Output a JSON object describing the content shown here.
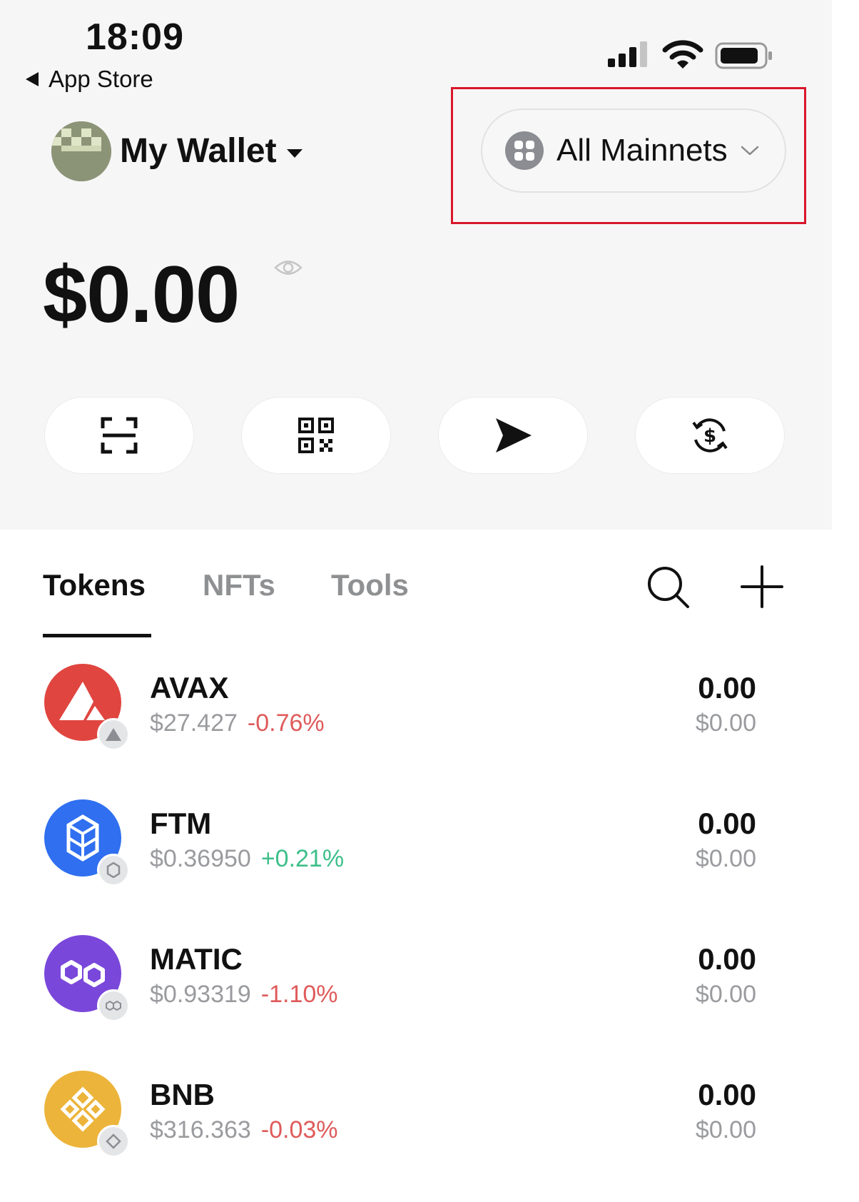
{
  "status_bar": {
    "time": "18:09",
    "back_label": "App Store"
  },
  "header": {
    "wallet_name": "My Wallet",
    "network_label": "All Mainnets"
  },
  "balance": {
    "amount": "$0.00"
  },
  "actions": [
    {
      "icon": "scan-icon"
    },
    {
      "icon": "qr-code-icon"
    },
    {
      "icon": "send-icon"
    },
    {
      "icon": "swap-dollar-icon"
    }
  ],
  "tabs": [
    {
      "label": "Tokens",
      "active": true
    },
    {
      "label": "NFTs",
      "active": false
    },
    {
      "label": "Tools",
      "active": false
    }
  ],
  "tokens": [
    {
      "symbol": "AVAX",
      "price": "$27.427",
      "change": "-0.76%",
      "amount": "0.00",
      "value": "$0.00",
      "color": "#e0453f"
    },
    {
      "symbol": "FTM",
      "price": "$0.36950",
      "change": "+0.21%",
      "amount": "0.00",
      "value": "$0.00",
      "color": "#2f6ff0"
    },
    {
      "symbol": "MATIC",
      "price": "$0.93319",
      "change": "-1.10%",
      "amount": "0.00",
      "value": "$0.00",
      "color": "#7a47db"
    },
    {
      "symbol": "BNB",
      "price": "$316.363",
      "change": "-0.03%",
      "amount": "0.00",
      "value": "$0.00",
      "color": "#ecb43a"
    }
  ]
}
